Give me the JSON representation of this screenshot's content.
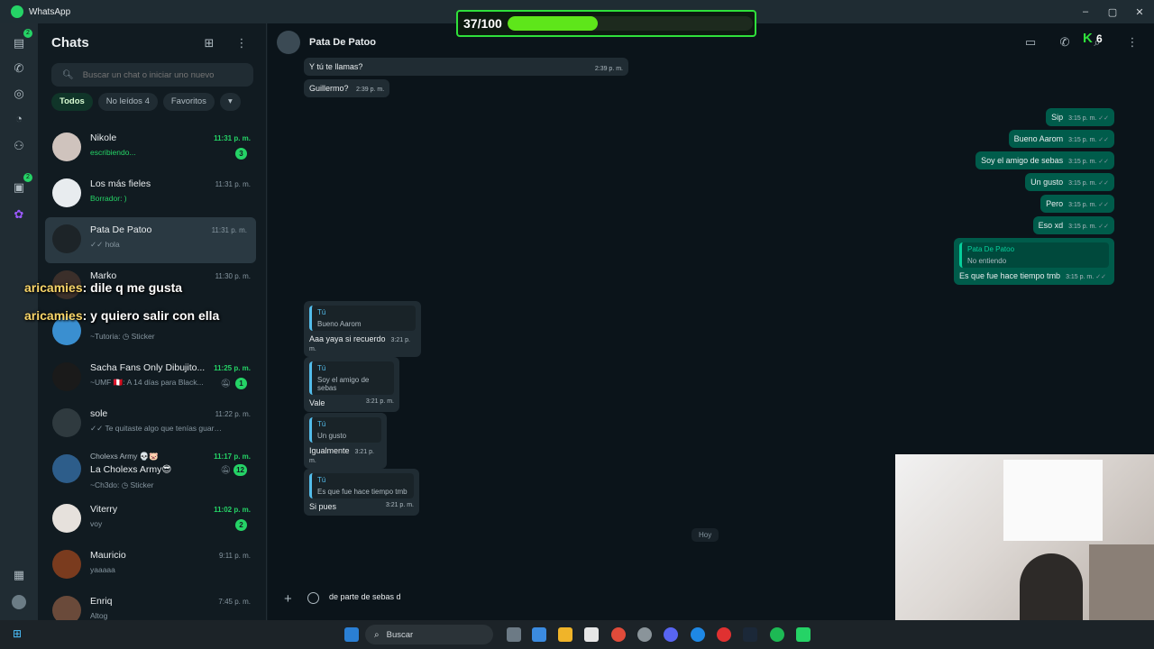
{
  "window": {
    "title": "WhatsApp",
    "minimize": "–",
    "maximize": "▢",
    "close": "✕"
  },
  "rail": {
    "chats_badge": "2",
    "channels_badge": "2"
  },
  "panel": {
    "title": "Chats",
    "new_chat_icon": "compose-icon",
    "menu_icon": "kebab-icon",
    "search_placeholder": "Buscar un chat o iniciar uno nuevo",
    "filters": [
      {
        "label": "Todos"
      },
      {
        "label": "No leídos 4"
      },
      {
        "label": "Favoritos"
      },
      {
        "label": "▾"
      }
    ]
  },
  "chats": [
    {
      "name": "Nikole",
      "preview": "escribiendo...",
      "time": "11:31 p. m.",
      "badge": "3"
    },
    {
      "name": "Los más fieles",
      "preview": "Borrador: )",
      "time": "11:31 p. m.",
      "badge": ""
    },
    {
      "name": "Pata De Patoo",
      "preview": "✓✓ hola",
      "time": "11:31 p. m.",
      "badge": ""
    },
    {
      "name": "Marko",
      "preview": "✓✓",
      "time": "11:30 p. m.",
      "badge": ""
    },
    {
      "name": "",
      "preview": "~Tutoria: ◷ Sticker",
      "time": "",
      "badge": ""
    },
    {
      "name": "Sacha Fans Only Dibujito...",
      "preview": "~UMF 🇵🇪: A 14 días para Black...",
      "time": "11:25 p. m.",
      "badge": "1"
    },
    {
      "name": "sole",
      "preview": "✓✓ Te quitaste algo que tenías guardad...",
      "time": "11:22 p. m.",
      "badge": ""
    },
    {
      "name": "La Cholexs Army😎",
      "group": "Cholexs Army 💀🐷",
      "preview": "~Ch3do: ◷ Sticker",
      "time": "11:17 p. m.",
      "badge": "12"
    },
    {
      "name": "Viterry",
      "preview": "voy",
      "time": "11:02 p. m.",
      "badge": "2"
    },
    {
      "name": "Mauricio",
      "preview": "yaaaaa",
      "time": "9:11 p. m.",
      "badge": ""
    },
    {
      "name": "Enriq",
      "preview": "Altog",
      "time": "7:45 p. m.",
      "badge": ""
    }
  ],
  "conversation": {
    "contact": "Pata De Patoo",
    "incoming_top": [
      {
        "text": "Y tú te llamas?",
        "time": "2:39 p. m."
      },
      {
        "text": "Guillermo?",
        "time": "2:39 p. m."
      }
    ],
    "outgoing": [
      {
        "text": "Sip",
        "time": "3:15 p. m."
      },
      {
        "text": "Bueno Aarom",
        "time": "3:15 p. m."
      },
      {
        "text": "Soy el amigo de sebas",
        "time": "3:15 p. m."
      },
      {
        "text": "Un gusto",
        "time": "3:15 p. m."
      },
      {
        "text": "Pero",
        "time": "3:15 p. m."
      },
      {
        "text": "Eso xd",
        "time": "3:15 p. m."
      }
    ],
    "reply_out": {
      "quote_author": "Pata De Patoo",
      "quote_text": "No entiendo",
      "text": "Es que fue hace tiempo tmb",
      "time": "3:15 p. m."
    },
    "replies_in": [
      {
        "quote_author": "Tú",
        "quote_text": "Bueno Aarom",
        "text": "Aaa yaya si recuerdo",
        "time": "3:21 p. m."
      },
      {
        "quote_author": "Tú",
        "quote_text": "Soy el amigo de sebas",
        "text": "Vale",
        "time": "3:21 p. m."
      },
      {
        "quote_author": "Tú",
        "quote_text": "Un gusto",
        "text": "Igualmente",
        "time": "3:21 p. m."
      },
      {
        "quote_author": "Tú",
        "quote_text": "Es que fue hace tiempo tmb",
        "text": "Si pues",
        "time": "3:21 p. m."
      }
    ],
    "day_divider": "Hoy",
    "draft": "de parte de sebas d"
  },
  "overlays": {
    "progress": {
      "label": "37/100",
      "value": 37,
      "max": 100,
      "color": "#5ee61a"
    },
    "k_badge": {
      "letter": "K",
      "count": "6"
    },
    "chat_messages": [
      {
        "user": "aricamies",
        "text": ": dile q me gusta"
      },
      {
        "user": "aricamies",
        "text": ": y quiero salir con ella"
      }
    ]
  },
  "taskbar": {
    "search_label": "Buscar"
  },
  "colors": {
    "accent": "#25d366",
    "bubble_out": "#005c4b",
    "bubble_in": "#202c33",
    "background": "#0b141a"
  }
}
